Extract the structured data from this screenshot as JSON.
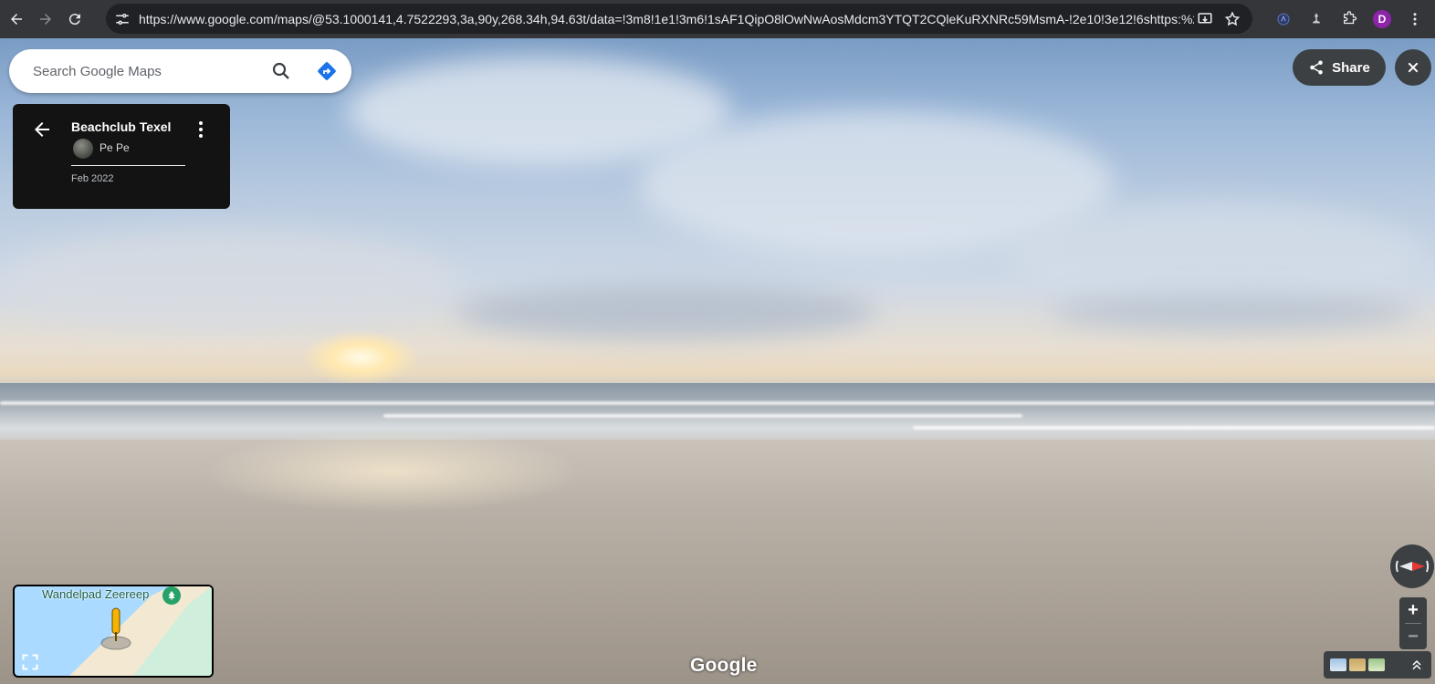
{
  "browser": {
    "url": "https://www.google.com/maps/@53.1000141,4.7522293,3a,90y,268.34h,94.63t/data=!3m8!1e1!3m6!1sAF1QipO8lOwNwAosMdcm3YTQT2CQleKuRXNRc59MsmA-!2e10!3e12!6shttps:%2...",
    "profile_initial": "D",
    "profile_color": "#8e24aa",
    "icons": {
      "back": "arrow-left-icon",
      "forward": "arrow-right-icon",
      "reload": "reload-icon",
      "site_info": "tune-icon",
      "install": "install-app-icon",
      "bookmark": "star-icon",
      "extension_1": "extension-badge-icon",
      "extension_2": "extension-pin-icon",
      "extensions": "puzzle-icon",
      "menu": "kebab-icon"
    }
  },
  "search": {
    "placeholder": "Search Google Maps",
    "value": ""
  },
  "place_card": {
    "title": "Beachclub Texel",
    "contributor": "Pe Pe",
    "date": "Feb 2022"
  },
  "share": {
    "label": "Share"
  },
  "minimap": {
    "label": "Wandelpad Zeereep"
  },
  "zoom": {
    "in_label": "+",
    "out_label": "−"
  },
  "branding": {
    "logo_text": "Google"
  },
  "colors": {
    "accent_blue": "#1a73e8",
    "dark_panel": "#131313",
    "control_bg": "#3c4043"
  }
}
